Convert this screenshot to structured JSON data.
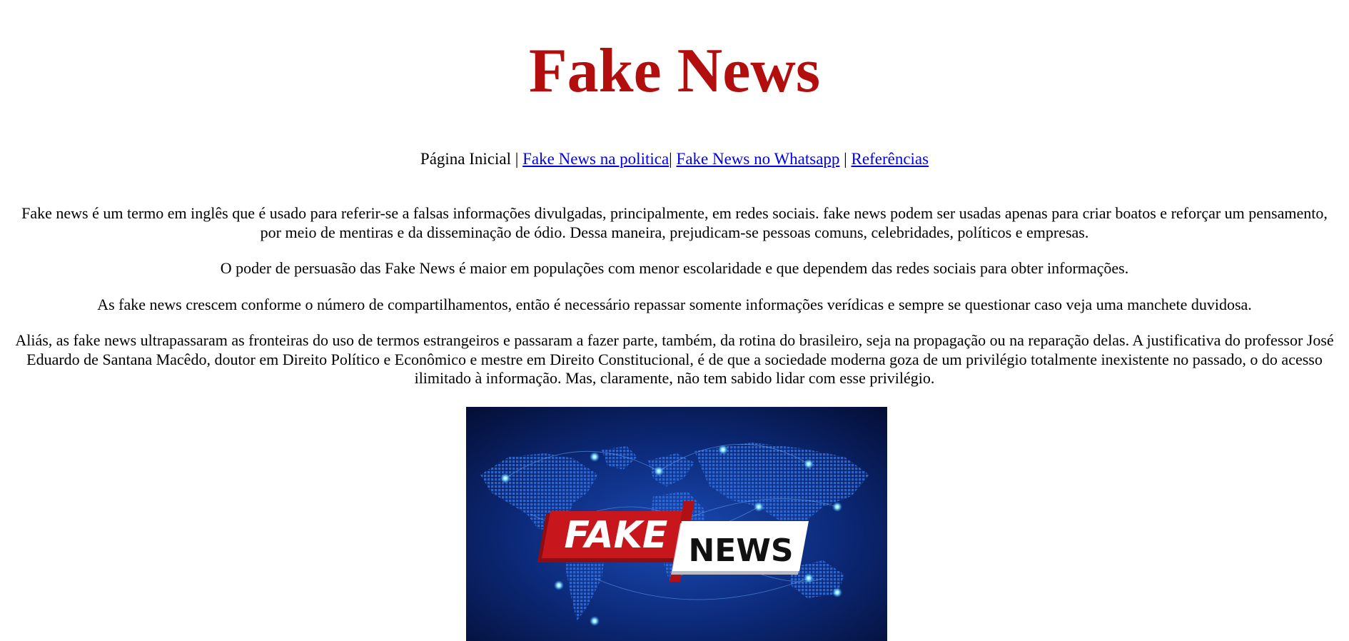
{
  "page": {
    "title": "Fake News"
  },
  "nav": {
    "home": "Página Inicial",
    "sep1": " | ",
    "politics": "Fake News na politica",
    "sep2": "| ",
    "whatsapp": "Fake News no Whatsapp",
    "sep3": " | ",
    "references": "Referências",
    "link_color": "#0000ee"
  },
  "content": {
    "paragraphs": [
      "Fake news é um termo em inglês que é usado para referir-se a falsas informações divulgadas, principalmente, em redes sociais. fake news podem ser usadas apenas para criar boatos e reforçar um pensamento, por meio de mentiras e da disseminação de ódio. Dessa maneira, prejudicam-se pessoas comuns, celebridades, políticos e empresas.",
      "O poder de persuasão das Fake News é maior em populações com menor escolaridade e que dependem das redes sociais para obter informações.",
      "As fake news crescem conforme o número de compartilhamentos, então é necessário repassar somente informações verídicas e sempre se questionar caso veja uma manchete duvidosa.",
      "Aliás, as fake news ultrapassaram as fronteiras do uso de termos estrangeiros e passaram a fazer parte, também, da rotina do brasileiro, seja na propagação ou na reparação delas. A justificativa do professor José Eduardo de Santana Macêdo, doutor em Direito Político e Econômico e mestre em Direito Constitucional, é de que a sociedade moderna goza de um privilégio totalmente inexistente no passado, o do acesso ilimitado à informação. Mas, claramente, não tem sabido lidar com esse privilégio."
    ]
  },
  "hero": {
    "word_red": "FAKE",
    "word_white": "NEWS",
    "colors": {
      "title_red": "#b30e0e",
      "bg_dark": "#061447",
      "bg_mid": "#0c2a7a",
      "badge_red": "#c8161d",
      "badge_white": "#ffffff"
    }
  }
}
